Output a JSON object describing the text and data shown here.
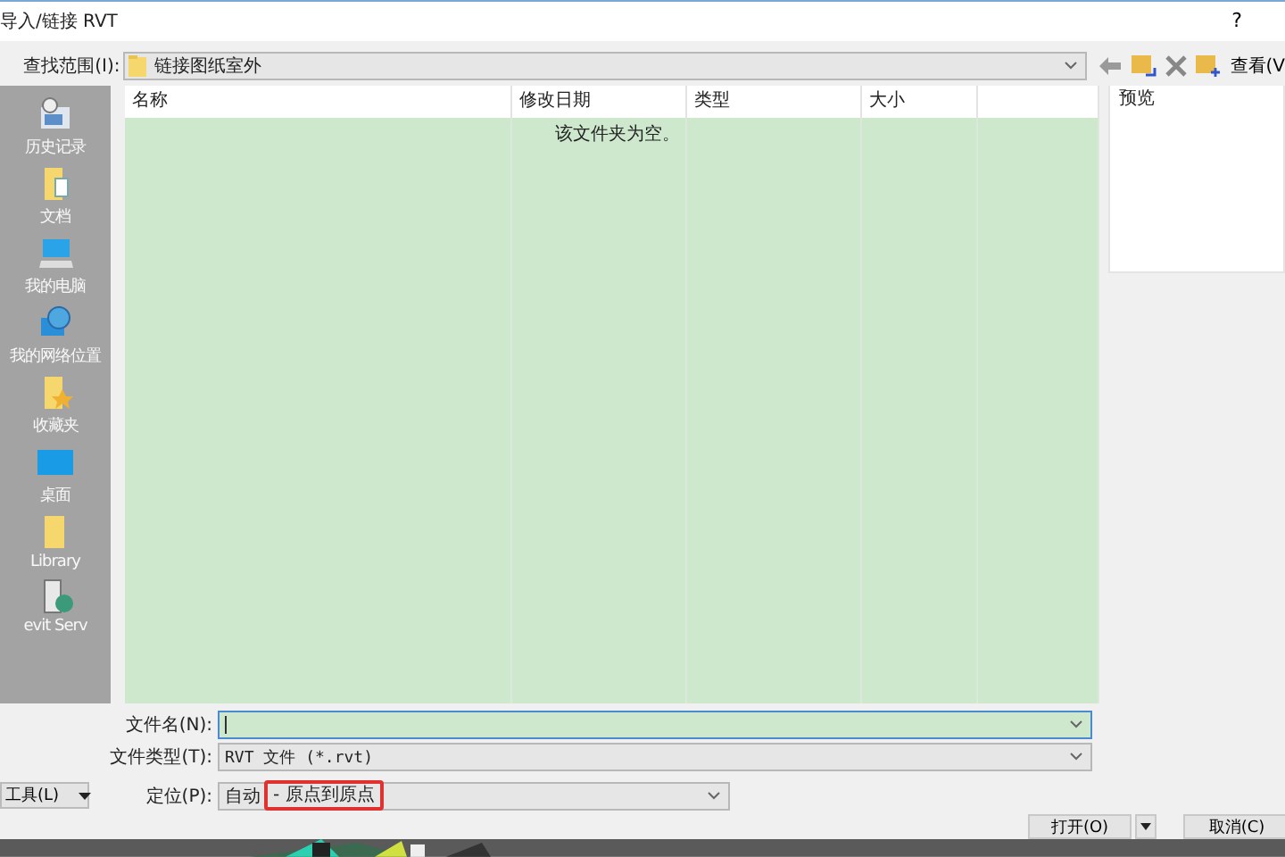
{
  "window": {
    "title": "导入/链接 RVT",
    "help": "?"
  },
  "look_in": {
    "label": "查找范围(I):",
    "value": "链接图纸室外"
  },
  "toolbar": {
    "view_label": "查看(V"
  },
  "sidebar": {
    "items": [
      {
        "label": "历史记录",
        "kind": "history"
      },
      {
        "label": "文档",
        "kind": "documents"
      },
      {
        "label": "我的电脑",
        "kind": "computer"
      },
      {
        "label": "我的网络位置",
        "kind": "network"
      },
      {
        "label": "收藏夹",
        "kind": "favorites"
      },
      {
        "label": "桌面",
        "kind": "desktop"
      },
      {
        "label": "Library",
        "kind": "folder"
      },
      {
        "label": "evit Serv",
        "kind": "server"
      }
    ]
  },
  "file_list": {
    "columns": [
      "名称",
      "修改日期",
      "类型",
      "大小"
    ],
    "empty_message": "该文件夹为空。"
  },
  "preview": {
    "label": "预览"
  },
  "file_name": {
    "label": "文件名(N):"
  },
  "file_type": {
    "label": "文件类型(T):",
    "value": "RVT 文件 (*.rvt)"
  },
  "position": {
    "label": "定位(P):",
    "value": "自动",
    "highlight": "- 原点到原点"
  },
  "tools_button": "工具(L)",
  "buttons": {
    "open": "打开(O)",
    "cancel": "取消(C)"
  }
}
